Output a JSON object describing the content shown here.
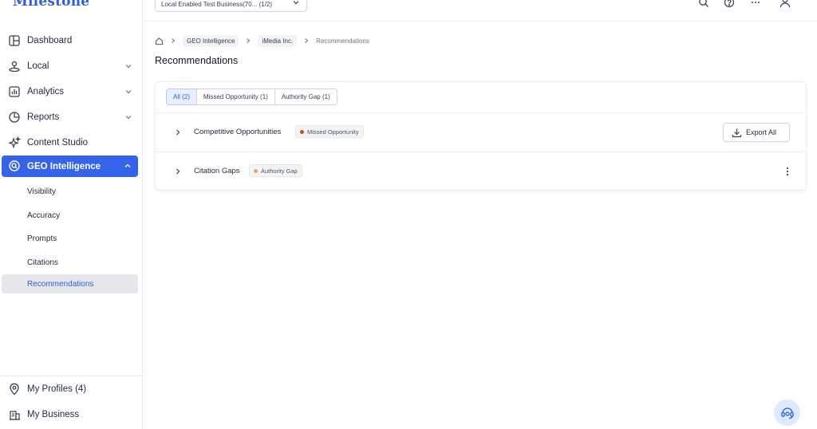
{
  "brand": {
    "logo_text": "Milestone"
  },
  "sidebar": {
    "items": [
      {
        "label": "Dashboard",
        "icon": "dashboard-icon",
        "expandable": false
      },
      {
        "label": "Local",
        "icon": "location-people-icon",
        "expandable": true
      },
      {
        "label": "Analytics",
        "icon": "analytics-icon",
        "expandable": true
      },
      {
        "label": "Reports",
        "icon": "pie-chart-icon",
        "expandable": true
      },
      {
        "label": "Content Studio",
        "icon": "sparkle-icon",
        "expandable": false
      },
      {
        "label": "GEO Intelligence",
        "icon": "geo-intelligence-icon",
        "expandable": true,
        "active": true
      }
    ],
    "sub_items": [
      {
        "label": "Visibility"
      },
      {
        "label": "Accuracy"
      },
      {
        "label": "Prompts"
      },
      {
        "label": "Citations"
      },
      {
        "label": "Recommendations",
        "selected": true
      }
    ],
    "bottom_items": [
      {
        "label": "My Profiles (4)",
        "icon": "map-pin-icon"
      },
      {
        "label": "My Business",
        "icon": "business-building-icon"
      }
    ]
  },
  "header": {
    "business_selector": "Local Enabled Test Business(70... (1/2)",
    "icons": [
      "search-icon",
      "help-icon",
      "apps-grid-icon",
      "user-icon"
    ]
  },
  "breadcrumb": {
    "items": [
      "GEO Intelligence",
      "iMedia Inc.",
      "Recommendations"
    ]
  },
  "page": {
    "title": "Recommendations"
  },
  "tabs": [
    {
      "label": "All (2)",
      "active": true
    },
    {
      "label": "Missed Opportunity (1)",
      "active": false
    },
    {
      "label": "Authority Gap (1)",
      "active": false
    }
  ],
  "rows": [
    {
      "label": "Competitive Opportunities",
      "badge": "Missed Opportunity",
      "badge_color": "#d9480f",
      "action": "Export All"
    },
    {
      "label": "Citation Gaps",
      "badge": "Authority Gap",
      "badge_color": "#f0a35e"
    }
  ],
  "colors": {
    "accent": "#3563e9",
    "brand": "#2f5fd8"
  }
}
